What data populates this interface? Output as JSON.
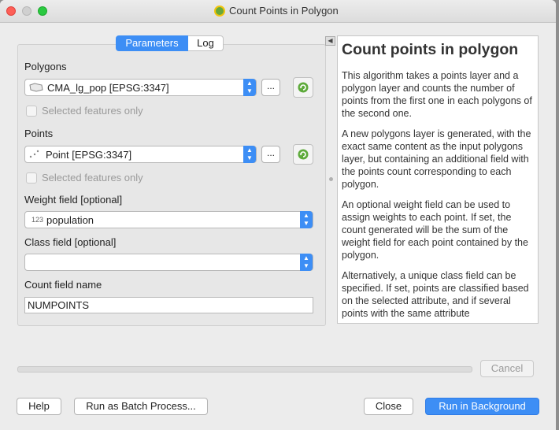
{
  "window": {
    "title": "Count Points in Polygon"
  },
  "tabs": [
    {
      "label": "Parameters"
    },
    {
      "label": "Log"
    }
  ],
  "form": {
    "polygons_label": "Polygons",
    "polygons_value": "CMA_lg_pop [EPSG:3347]",
    "polygons_selected_only": "Selected features only",
    "points_label": "Points",
    "points_value": "Point [EPSG:3347]",
    "points_selected_only": "Selected features only",
    "weight_label": "Weight field [optional]",
    "weight_type": "123",
    "weight_value": "population",
    "class_label": "Class field [optional]",
    "class_value": "",
    "count_label": "Count field name",
    "count_value": "NUMPOINTS",
    "browse_label": "..."
  },
  "help": {
    "title": "Count points in polygon",
    "paragraphs": [
      "This algorithm takes a points layer and a polygon layer and counts the number of points from the first one in each polygons of the second one.",
      "A new polygons layer is generated, with the exact same content as the input polygons layer, but containing an additional field with the points count corresponding to each polygon.",
      "An optional weight field can be used to assign weights to each point. If set, the count generated will be the sum of the weight field for each point contained by the polygon.",
      "Alternatively, a unique class field can be specified. If set, points are classified based on the selected attribute, and if several points with the same attribute"
    ]
  },
  "buttons": {
    "cancel": "Cancel",
    "help": "Help",
    "batch": "Run as Batch Process...",
    "close": "Close",
    "run": "Run in Background"
  },
  "progress": 0
}
